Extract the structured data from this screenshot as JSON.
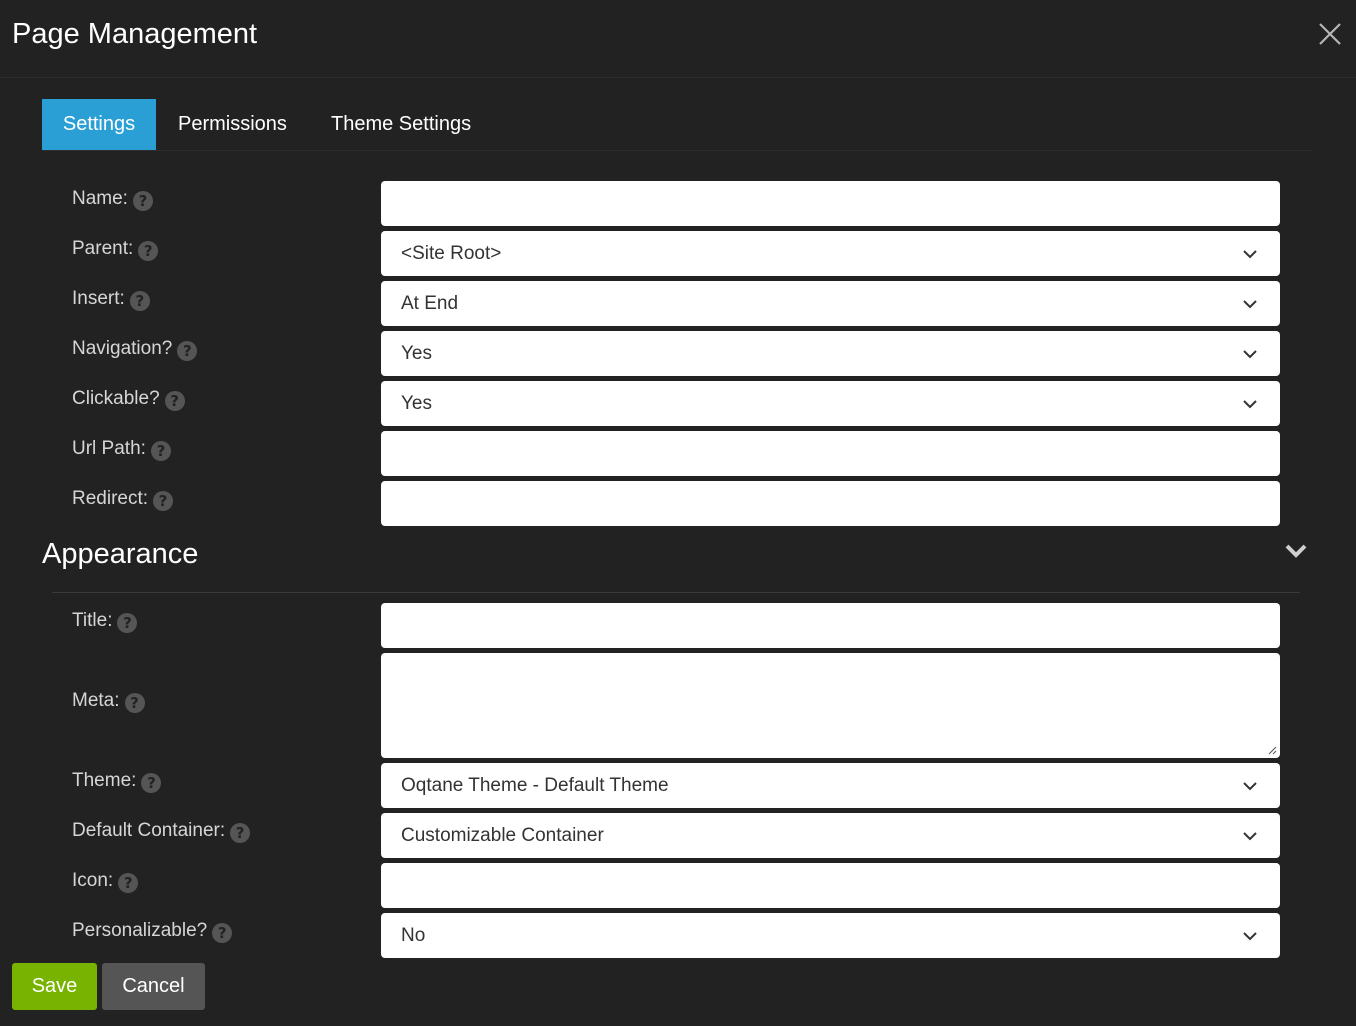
{
  "header": {
    "title": "Page Management",
    "close_icon": "close-icon"
  },
  "tabs": [
    {
      "label": "Settings",
      "active": true
    },
    {
      "label": "Permissions",
      "active": false
    },
    {
      "label": "Theme Settings",
      "active": false
    }
  ],
  "settings": {
    "name": {
      "label": "Name:",
      "value": ""
    },
    "parent": {
      "label": "Parent:",
      "value": "<Site Root>"
    },
    "insert": {
      "label": "Insert:",
      "value": "At End"
    },
    "navigation": {
      "label": "Navigation?",
      "value": "Yes"
    },
    "clickable": {
      "label": "Clickable?",
      "value": "Yes"
    },
    "url_path": {
      "label": "Url Path:",
      "value": ""
    },
    "redirect": {
      "label": "Redirect:",
      "value": ""
    }
  },
  "appearance": {
    "section_title": "Appearance",
    "title": {
      "label": "Title:",
      "value": ""
    },
    "meta": {
      "label": "Meta:",
      "value": ""
    },
    "theme": {
      "label": "Theme:",
      "value": "Oqtane Theme - Default Theme"
    },
    "default_container": {
      "label": "Default Container:",
      "value": "Customizable Container"
    },
    "icon": {
      "label": "Icon:",
      "value": ""
    },
    "personalizable": {
      "label": "Personalizable?",
      "value": "No"
    }
  },
  "help_glyph": "?",
  "actions": {
    "save_label": "Save",
    "cancel_label": "Cancel"
  },
  "colors": {
    "background": "#222222",
    "active_tab": "#2a9fd6",
    "save_button": "#77b300",
    "cancel_button": "#555555",
    "help_icon": "#555555"
  }
}
